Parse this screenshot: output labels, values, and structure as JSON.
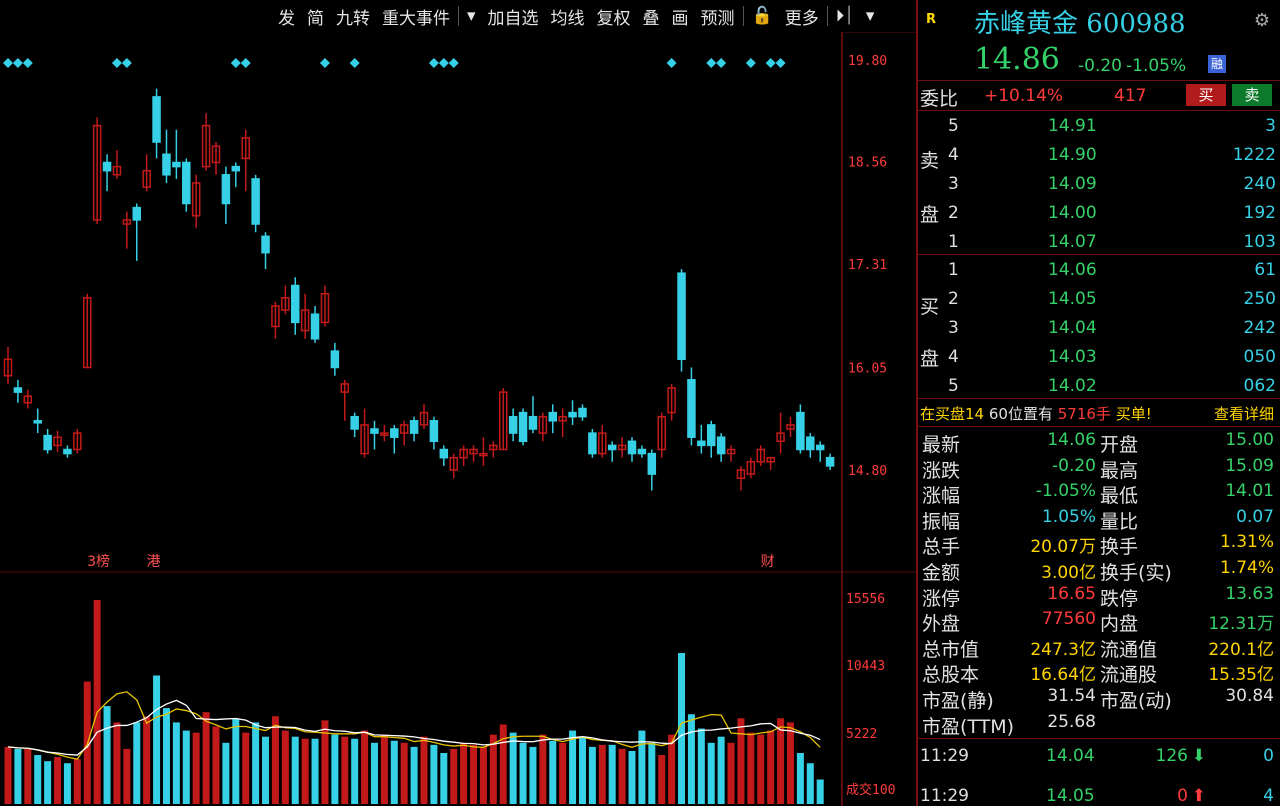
{
  "toolbar": {
    "items": [
      "发",
      "简",
      "九转",
      "重大事件",
      "▾",
      "加自选",
      "均线",
      "复权",
      "叠",
      "画",
      "预测",
      "🔓",
      "更多",
      "⏵⏐",
      "▾"
    ]
  },
  "chart": {
    "price_ticks": [
      "19.80",
      "18.56",
      "17.31",
      "16.05",
      "14.80"
    ],
    "volume_ticks": [
      "15556",
      "10443",
      "5222",
      "成交100"
    ],
    "markers": [
      "3榜",
      "港",
      "财"
    ],
    "colors": {
      "up": "#c21a1a",
      "down": "#36d1e6",
      "ma1": "#e6c200",
      "ma2": "#ffffff",
      "grid": "#5a0b0b"
    }
  },
  "chart_data": {
    "type": "candlestick",
    "candles": [
      {
        "o": 15.95,
        "c": 16.15,
        "h": 16.3,
        "l": 15.85
      },
      {
        "o": 15.8,
        "c": 15.75,
        "h": 15.9,
        "l": 15.62
      },
      {
        "o": 15.62,
        "c": 15.7,
        "h": 15.78,
        "l": 15.55
      },
      {
        "o": 15.4,
        "c": 15.38,
        "h": 15.55,
        "l": 15.25
      },
      {
        "o": 15.22,
        "c": 15.05,
        "h": 15.3,
        "l": 15.0
      },
      {
        "o": 15.1,
        "c": 15.2,
        "h": 15.28,
        "l": 15.02
      },
      {
        "o": 15.05,
        "c": 15.0,
        "h": 15.1,
        "l": 14.95
      },
      {
        "o": 15.05,
        "c": 15.25,
        "h": 15.3,
        "l": 15.0
      },
      {
        "o": 16.05,
        "c": 16.9,
        "h": 16.95,
        "l": 16.05
      },
      {
        "o": 17.85,
        "c": 19.0,
        "h": 19.1,
        "l": 17.8
      },
      {
        "o": 18.55,
        "c": 18.45,
        "h": 18.65,
        "l": 18.2
      },
      {
        "o": 18.4,
        "c": 18.5,
        "h": 18.7,
        "l": 18.35
      },
      {
        "o": 17.8,
        "c": 17.85,
        "h": 17.95,
        "l": 17.5
      },
      {
        "o": 18.0,
        "c": 17.85,
        "h": 18.05,
        "l": 17.35
      },
      {
        "o": 18.25,
        "c": 18.45,
        "h": 18.65,
        "l": 18.2
      },
      {
        "o": 19.35,
        "c": 18.8,
        "h": 19.45,
        "l": 18.6
      },
      {
        "o": 18.65,
        "c": 18.4,
        "h": 18.95,
        "l": 18.3
      },
      {
        "o": 18.55,
        "c": 18.5,
        "h": 18.95,
        "l": 18.35
      },
      {
        "o": 18.55,
        "c": 18.05,
        "h": 18.6,
        "l": 17.95
      },
      {
        "o": 17.9,
        "c": 18.3,
        "h": 18.4,
        "l": 17.75
      },
      {
        "o": 18.5,
        "c": 19.0,
        "h": 19.15,
        "l": 18.45
      },
      {
        "o": 18.55,
        "c": 18.75,
        "h": 18.8,
        "l": 18.4
      },
      {
        "o": 18.4,
        "c": 18.05,
        "h": 18.5,
        "l": 17.8
      },
      {
        "o": 18.5,
        "c": 18.45,
        "h": 18.55,
        "l": 18.25
      },
      {
        "o": 18.6,
        "c": 18.85,
        "h": 18.95,
        "l": 18.2
      },
      {
        "o": 18.35,
        "c": 17.8,
        "h": 18.4,
        "l": 17.7
      },
      {
        "o": 17.65,
        "c": 17.45,
        "h": 17.7,
        "l": 17.25
      },
      {
        "o": 16.55,
        "c": 16.8,
        "h": 16.85,
        "l": 16.4
      },
      {
        "o": 16.75,
        "c": 16.9,
        "h": 17.05,
        "l": 16.7
      },
      {
        "o": 17.05,
        "c": 16.6,
        "h": 17.15,
        "l": 16.45
      },
      {
        "o": 16.5,
        "c": 16.75,
        "h": 16.95,
        "l": 16.4
      },
      {
        "o": 16.7,
        "c": 16.4,
        "h": 16.8,
        "l": 16.35
      },
      {
        "o": 16.6,
        "c": 16.95,
        "h": 17.05,
        "l": 16.55
      },
      {
        "o": 16.25,
        "c": 16.05,
        "h": 16.35,
        "l": 15.95
      },
      {
        "o": 15.75,
        "c": 15.85,
        "h": 15.9,
        "l": 15.4
      },
      {
        "o": 15.45,
        "c": 15.3,
        "h": 15.5,
        "l": 15.2
      },
      {
        "o": 15.0,
        "c": 15.35,
        "h": 15.55,
        "l": 14.95
      },
      {
        "o": 15.3,
        "c": 15.25,
        "h": 15.4,
        "l": 15.05
      },
      {
        "o": 15.25,
        "c": 15.25,
        "h": 15.35,
        "l": 15.15
      },
      {
        "o": 15.3,
        "c": 15.2,
        "h": 15.35,
        "l": 15.0
      },
      {
        "o": 15.25,
        "c": 15.35,
        "h": 15.4,
        "l": 15.1
      },
      {
        "o": 15.4,
        "c": 15.25,
        "h": 15.45,
        "l": 15.15
      },
      {
        "o": 15.35,
        "c": 15.5,
        "h": 15.6,
        "l": 15.3
      },
      {
        "o": 15.4,
        "c": 15.15,
        "h": 15.45,
        "l": 15.05
      },
      {
        "o": 15.05,
        "c": 14.95,
        "h": 15.1,
        "l": 14.85
      },
      {
        "o": 14.8,
        "c": 14.95,
        "h": 15.0,
        "l": 14.7
      },
      {
        "o": 14.95,
        "c": 15.05,
        "h": 15.1,
        "l": 14.85
      },
      {
        "o": 15.0,
        "c": 15.05,
        "h": 15.1,
        "l": 14.9
      },
      {
        "o": 15.0,
        "c": 15.0,
        "h": 15.2,
        "l": 14.85
      },
      {
        "o": 15.05,
        "c": 15.1,
        "h": 15.15,
        "l": 14.95
      },
      {
        "o": 15.05,
        "c": 15.75,
        "h": 15.8,
        "l": 15.05
      },
      {
        "o": 15.45,
        "c": 15.25,
        "h": 15.55,
        "l": 15.15
      },
      {
        "o": 15.5,
        "c": 15.15,
        "h": 15.55,
        "l": 15.1
      },
      {
        "o": 15.45,
        "c": 15.3,
        "h": 15.7,
        "l": 15.25
      },
      {
        "o": 15.25,
        "c": 15.45,
        "h": 15.5,
        "l": 15.15
      },
      {
        "o": 15.5,
        "c": 15.4,
        "h": 15.6,
        "l": 15.25
      },
      {
        "o": 15.4,
        "c": 15.45,
        "h": 15.55,
        "l": 15.2
      },
      {
        "o": 15.5,
        "c": 15.45,
        "h": 15.65,
        "l": 15.35
      },
      {
        "o": 15.55,
        "c": 15.45,
        "h": 15.6,
        "l": 15.4
      },
      {
        "o": 15.25,
        "c": 15.0,
        "h": 15.3,
        "l": 14.95
      },
      {
        "o": 15.0,
        "c": 15.25,
        "h": 15.35,
        "l": 14.95
      },
      {
        "o": 15.1,
        "c": 15.05,
        "h": 15.15,
        "l": 14.9
      },
      {
        "o": 15.05,
        "c": 15.1,
        "h": 15.2,
        "l": 14.95
      },
      {
        "o": 15.15,
        "c": 15.0,
        "h": 15.2,
        "l": 14.9
      },
      {
        "o": 15.05,
        "c": 15.0,
        "h": 15.1,
        "l": 14.95
      },
      {
        "o": 15.0,
        "c": 14.75,
        "h": 15.05,
        "l": 14.55
      },
      {
        "o": 15.05,
        "c": 15.45,
        "h": 15.5,
        "l": 14.95
      },
      {
        "o": 15.5,
        "c": 15.8,
        "h": 15.85,
        "l": 15.4
      },
      {
        "o": 17.2,
        "c": 16.15,
        "h": 17.25,
        "l": 16.0
      },
      {
        "o": 15.9,
        "c": 15.2,
        "h": 16.05,
        "l": 15.1
      },
      {
        "o": 15.15,
        "c": 15.1,
        "h": 15.35,
        "l": 15.0
      },
      {
        "o": 15.35,
        "c": 15.1,
        "h": 15.4,
        "l": 14.95
      },
      {
        "o": 15.2,
        "c": 15.0,
        "h": 15.25,
        "l": 14.9
      },
      {
        "o": 15.0,
        "c": 15.05,
        "h": 15.1,
        "l": 14.9
      },
      {
        "o": 14.7,
        "c": 14.8,
        "h": 14.85,
        "l": 14.55
      },
      {
        "o": 14.75,
        "c": 14.9,
        "h": 14.95,
        "l": 14.7
      },
      {
        "o": 14.9,
        "c": 15.05,
        "h": 15.1,
        "l": 14.85
      },
      {
        "o": 14.9,
        "c": 14.95,
        "h": 14.95,
        "l": 14.8
      },
      {
        "o": 15.15,
        "c": 15.25,
        "h": 15.5,
        "l": 15.0
      },
      {
        "o": 15.3,
        "c": 15.35,
        "h": 15.45,
        "l": 15.2
      },
      {
        "o": 15.5,
        "c": 15.05,
        "h": 15.6,
        "l": 15.0
      },
      {
        "o": 15.2,
        "c": 15.05,
        "h": 15.25,
        "l": 14.95
      },
      {
        "o": 15.1,
        "c": 15.05,
        "h": 15.15,
        "l": 14.9
      },
      {
        "o": 14.95,
        "c": 14.85,
        "h": 15.0,
        "l": 14.8
      }
    ],
    "volume": [
      28,
      27,
      27,
      24,
      21,
      23,
      20,
      22,
      60,
      100,
      48,
      40,
      27,
      40,
      43,
      63,
      47,
      40,
      36,
      35,
      45,
      38,
      30,
      42,
      35,
      40,
      33,
      43,
      36,
      33,
      32,
      32,
      41,
      34,
      33,
      32,
      36,
      30,
      34,
      31,
      30,
      28,
      33,
      29,
      25,
      27,
      30,
      29,
      28,
      34,
      39,
      35,
      30,
      28,
      34,
      31,
      30,
      36,
      33,
      28,
      29,
      29,
      27,
      26,
      36,
      30,
      24,
      34,
      74,
      44,
      37,
      30,
      33,
      30,
      42,
      35,
      34,
      36,
      42,
      40,
      25,
      20,
      12
    ],
    "ylim": [
      14.8,
      19.8
    ],
    "volume_max": 15556
  },
  "panel": {
    "badge": "R",
    "name": "赤峰黄金",
    "code": "600988",
    "price": "14.86",
    "change": "-0.20",
    "change_pct": "-1.05%",
    "flag": "融",
    "weibi_label": "委比",
    "weibi": "+10.14%",
    "weicha": "417",
    "buy_btn": "买",
    "sell_btn": "卖",
    "ask_label": [
      "卖",
      "盘"
    ],
    "bid_label": [
      "买",
      "盘"
    ],
    "asks": [
      {
        "lvl": "5",
        "price": "14.91",
        "vol": "3"
      },
      {
        "lvl": "4",
        "price": "14.90",
        "vol": "1222"
      },
      {
        "lvl": "3",
        "price": "14.09",
        "vol": "240"
      },
      {
        "lvl": "2",
        "price": "14.00",
        "vol": "192"
      },
      {
        "lvl": "1",
        "price": "14.07",
        "vol": "103"
      }
    ],
    "bids": [
      {
        "lvl": "1",
        "price": "14.06",
        "vol": "61"
      },
      {
        "lvl": "2",
        "price": "14.05",
        "vol": "250"
      },
      {
        "lvl": "3",
        "price": "14.04",
        "vol": "242"
      },
      {
        "lvl": "4",
        "price": "14.03",
        "vol": "050"
      },
      {
        "lvl": "5",
        "price": "14.02",
        "vol": "062"
      }
    ],
    "notice_a": "在买盘14",
    "notice_b": "60位置有",
    "notice_c": "5716手",
    "notice_d": "买单!",
    "notice_link": "查看详细",
    "stats": [
      {
        "l1": "最新",
        "v1": "14.06",
        "c1": "g",
        "l2": "开盘",
        "v2": "15.00",
        "c2": "g"
      },
      {
        "l1": "涨跌",
        "v1": "-0.20",
        "c1": "g",
        "l2": "最高",
        "v2": "15.09",
        "c2": "g"
      },
      {
        "l1": "涨幅",
        "v1": "-1.05%",
        "c1": "g",
        "l2": "最低",
        "v2": "14.01",
        "c2": "g"
      },
      {
        "l1": "振幅",
        "v1": "1.05%",
        "c1": "c",
        "l2": "量比",
        "v2": "0.07",
        "c2": "c"
      },
      {
        "l1": "总手",
        "v1": "20.07万",
        "c1": "y",
        "l2": "换手",
        "v2": "1.31%",
        "c2": "y"
      },
      {
        "l1": "金额",
        "v1": "3.00亿",
        "c1": "y",
        "l2": "换手(实)",
        "v2": "1.74%",
        "c2": "y"
      },
      {
        "l1": "涨停",
        "v1": "16.65",
        "c1": "r",
        "l2": "跌停",
        "v2": "13.63",
        "c2": "g"
      },
      {
        "l1": "外盘",
        "v1": "77560",
        "c1": "r",
        "l2": "内盘",
        "v2": "12.31万",
        "c2": "g"
      },
      {
        "l1": "总市值",
        "v1": "247.3亿",
        "c1": "y",
        "l2": "流通值",
        "v2": "220.1亿",
        "c2": "y"
      },
      {
        "l1": "总股本",
        "v1": "16.64亿",
        "c1": "y",
        "l2": "流通股",
        "v2": "15.35亿",
        "c2": "y"
      },
      {
        "l1": "市盈(静)",
        "v1": "31.54",
        "c1": "w",
        "l2": "市盈(动)",
        "v2": "30.84",
        "c2": "w"
      },
      {
        "l1": "市盈(TTM)",
        "v1": "25.68",
        "c1": "w",
        "l2": "",
        "v2": "",
        "c2": "w"
      }
    ],
    "ticks": [
      {
        "time": "11:29",
        "price": "14.04",
        "vol": "126",
        "dir": "down",
        "n": "0"
      },
      {
        "time": "11:29",
        "price": "14.05",
        "vol": "0",
        "dir": "up",
        "n": "4"
      }
    ]
  }
}
